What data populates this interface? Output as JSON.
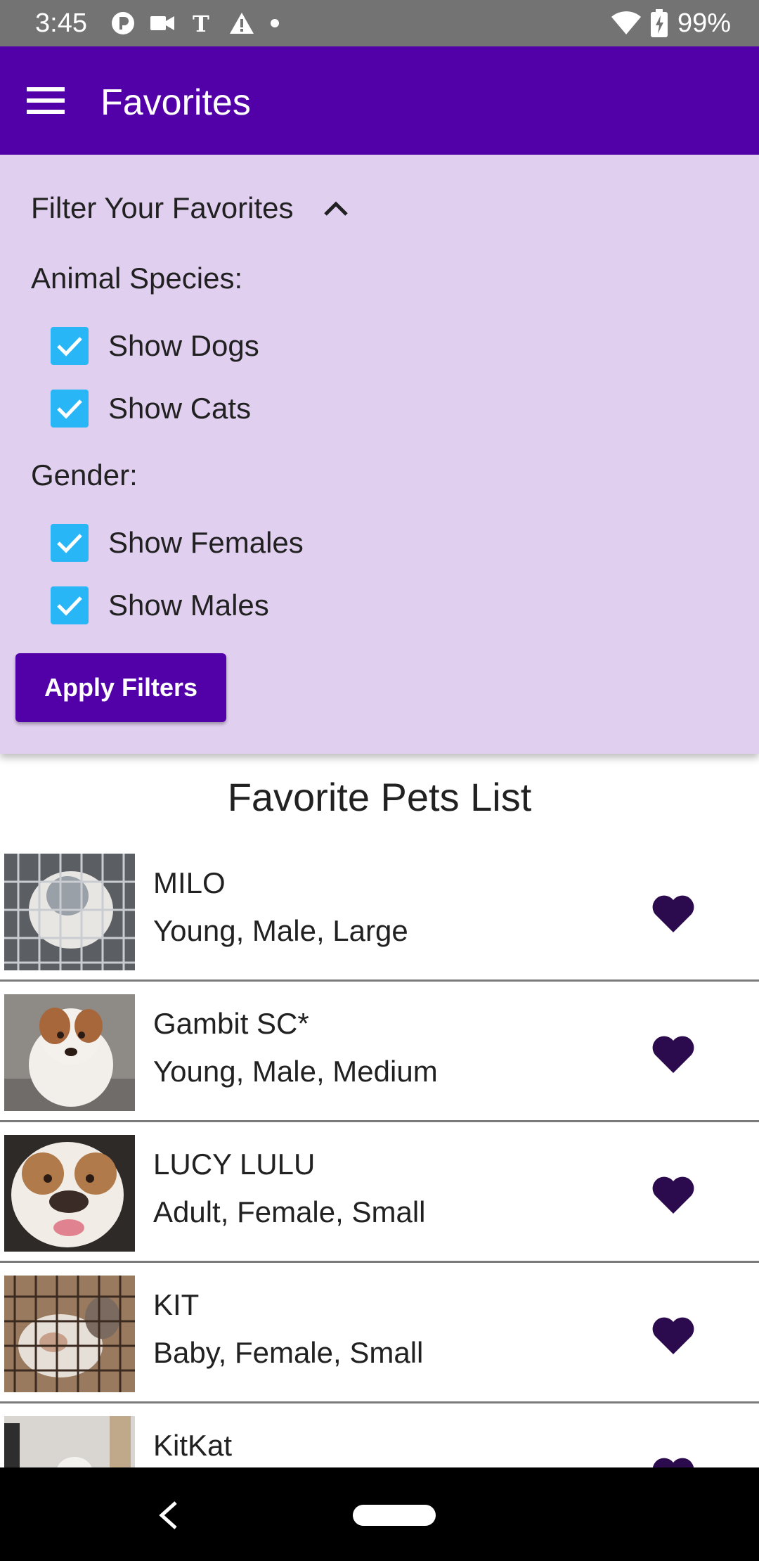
{
  "status_bar": {
    "time": "3:45",
    "battery": "99%"
  },
  "app_bar": {
    "title": "Favorites",
    "menu_icon": "hamburger-menu-icon"
  },
  "filter": {
    "toggle_label": "Filter Your Favorites",
    "species_label": "Animal Species:",
    "species": [
      {
        "label": "Show Dogs",
        "checked": true
      },
      {
        "label": "Show Cats",
        "checked": true
      }
    ],
    "gender_label": "Gender:",
    "gender": [
      {
        "label": "Show Females",
        "checked": true
      },
      {
        "label": "Show Males",
        "checked": true
      }
    ],
    "apply_label": "Apply Filters"
  },
  "list": {
    "title": "Favorite Pets List",
    "pets": [
      {
        "name": "MILO",
        "desc": "Young, Male, Large"
      },
      {
        "name": "Gambit SC*",
        "desc": "Young, Male, Medium"
      },
      {
        "name": "LUCY LULU",
        "desc": "Adult, Female, Small"
      },
      {
        "name": "KIT",
        "desc": "Baby, Female, Small"
      },
      {
        "name": "KitKat",
        "desc": ""
      }
    ]
  },
  "colors": {
    "primary": "#5200a8",
    "panel": "#e1cff0",
    "checkbox": "#29b6f6",
    "heart": "#2b0a4d"
  }
}
